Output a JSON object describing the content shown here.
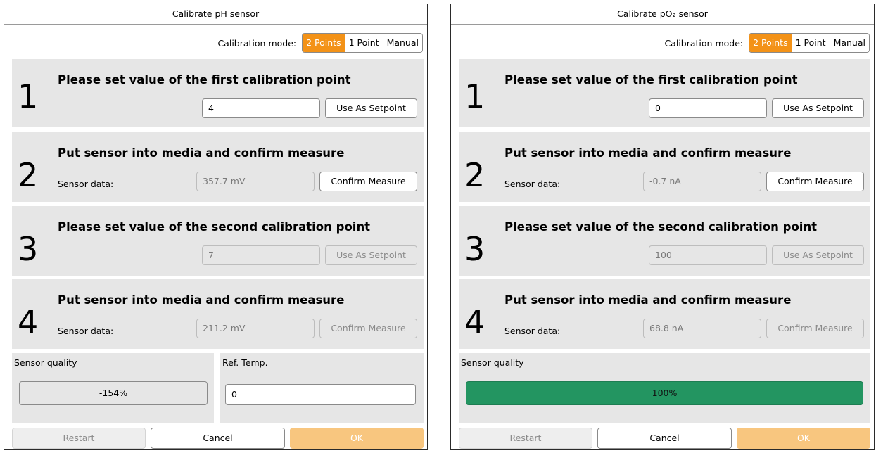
{
  "dialogs": {
    "ph": {
      "title": "Calibrate pH sensor",
      "mode_label": "Calibration mode:",
      "modes": [
        "2 Points",
        "1 Point",
        "Manual"
      ],
      "steps": [
        {
          "num": "1",
          "title": "Please set value of the first calibration point",
          "value": "4",
          "button": "Use As Setpoint"
        },
        {
          "num": "2",
          "title": "Put sensor into media and confirm measure",
          "sensor_label": "Sensor data:",
          "value": "357.7 mV",
          "button": "Confirm Measure"
        },
        {
          "num": "3",
          "title": "Please set value of the second calibration point",
          "value": "7",
          "button": "Use As Setpoint"
        },
        {
          "num": "4",
          "title": "Put sensor into media and confirm measure",
          "sensor_label": "Sensor data:",
          "value": "211.2 mV",
          "button": "Confirm Measure"
        }
      ],
      "quality_label": "Sensor quality",
      "quality_value": "-154%",
      "ref_temp_label": "Ref. Temp.",
      "ref_temp_value": "0",
      "restart": "Restart",
      "cancel": "Cancel",
      "ok": "OK"
    },
    "po": {
      "title": "Calibrate pO₂ sensor",
      "mode_label": "Calibration mode:",
      "modes": [
        "2 Points",
        "1 Point",
        "Manual"
      ],
      "steps": [
        {
          "num": "1",
          "title": "Please set value of the first calibration point",
          "value": "0",
          "button": "Use As Setpoint"
        },
        {
          "num": "2",
          "title": "Put sensor into media and confirm measure",
          "sensor_label": "Sensor data:",
          "value": "-0.7 nA",
          "button": "Confirm Measure"
        },
        {
          "num": "3",
          "title": "Please set value of the second calibration point",
          "value": "100",
          "button": "Use As Setpoint"
        },
        {
          "num": "4",
          "title": "Put sensor into media and confirm measure",
          "sensor_label": "Sensor data:",
          "value": "68.8 nA",
          "button": "Confirm Measure"
        }
      ],
      "quality_label": "Sensor quality",
      "quality_value": "100%",
      "quality_color": "#239561",
      "restart": "Restart",
      "cancel": "Cancel",
      "ok": "OK"
    }
  },
  "colors": {
    "accent": "#f39217",
    "ok_disabled": "#f8c67f",
    "panel": "#e6e6e6"
  }
}
